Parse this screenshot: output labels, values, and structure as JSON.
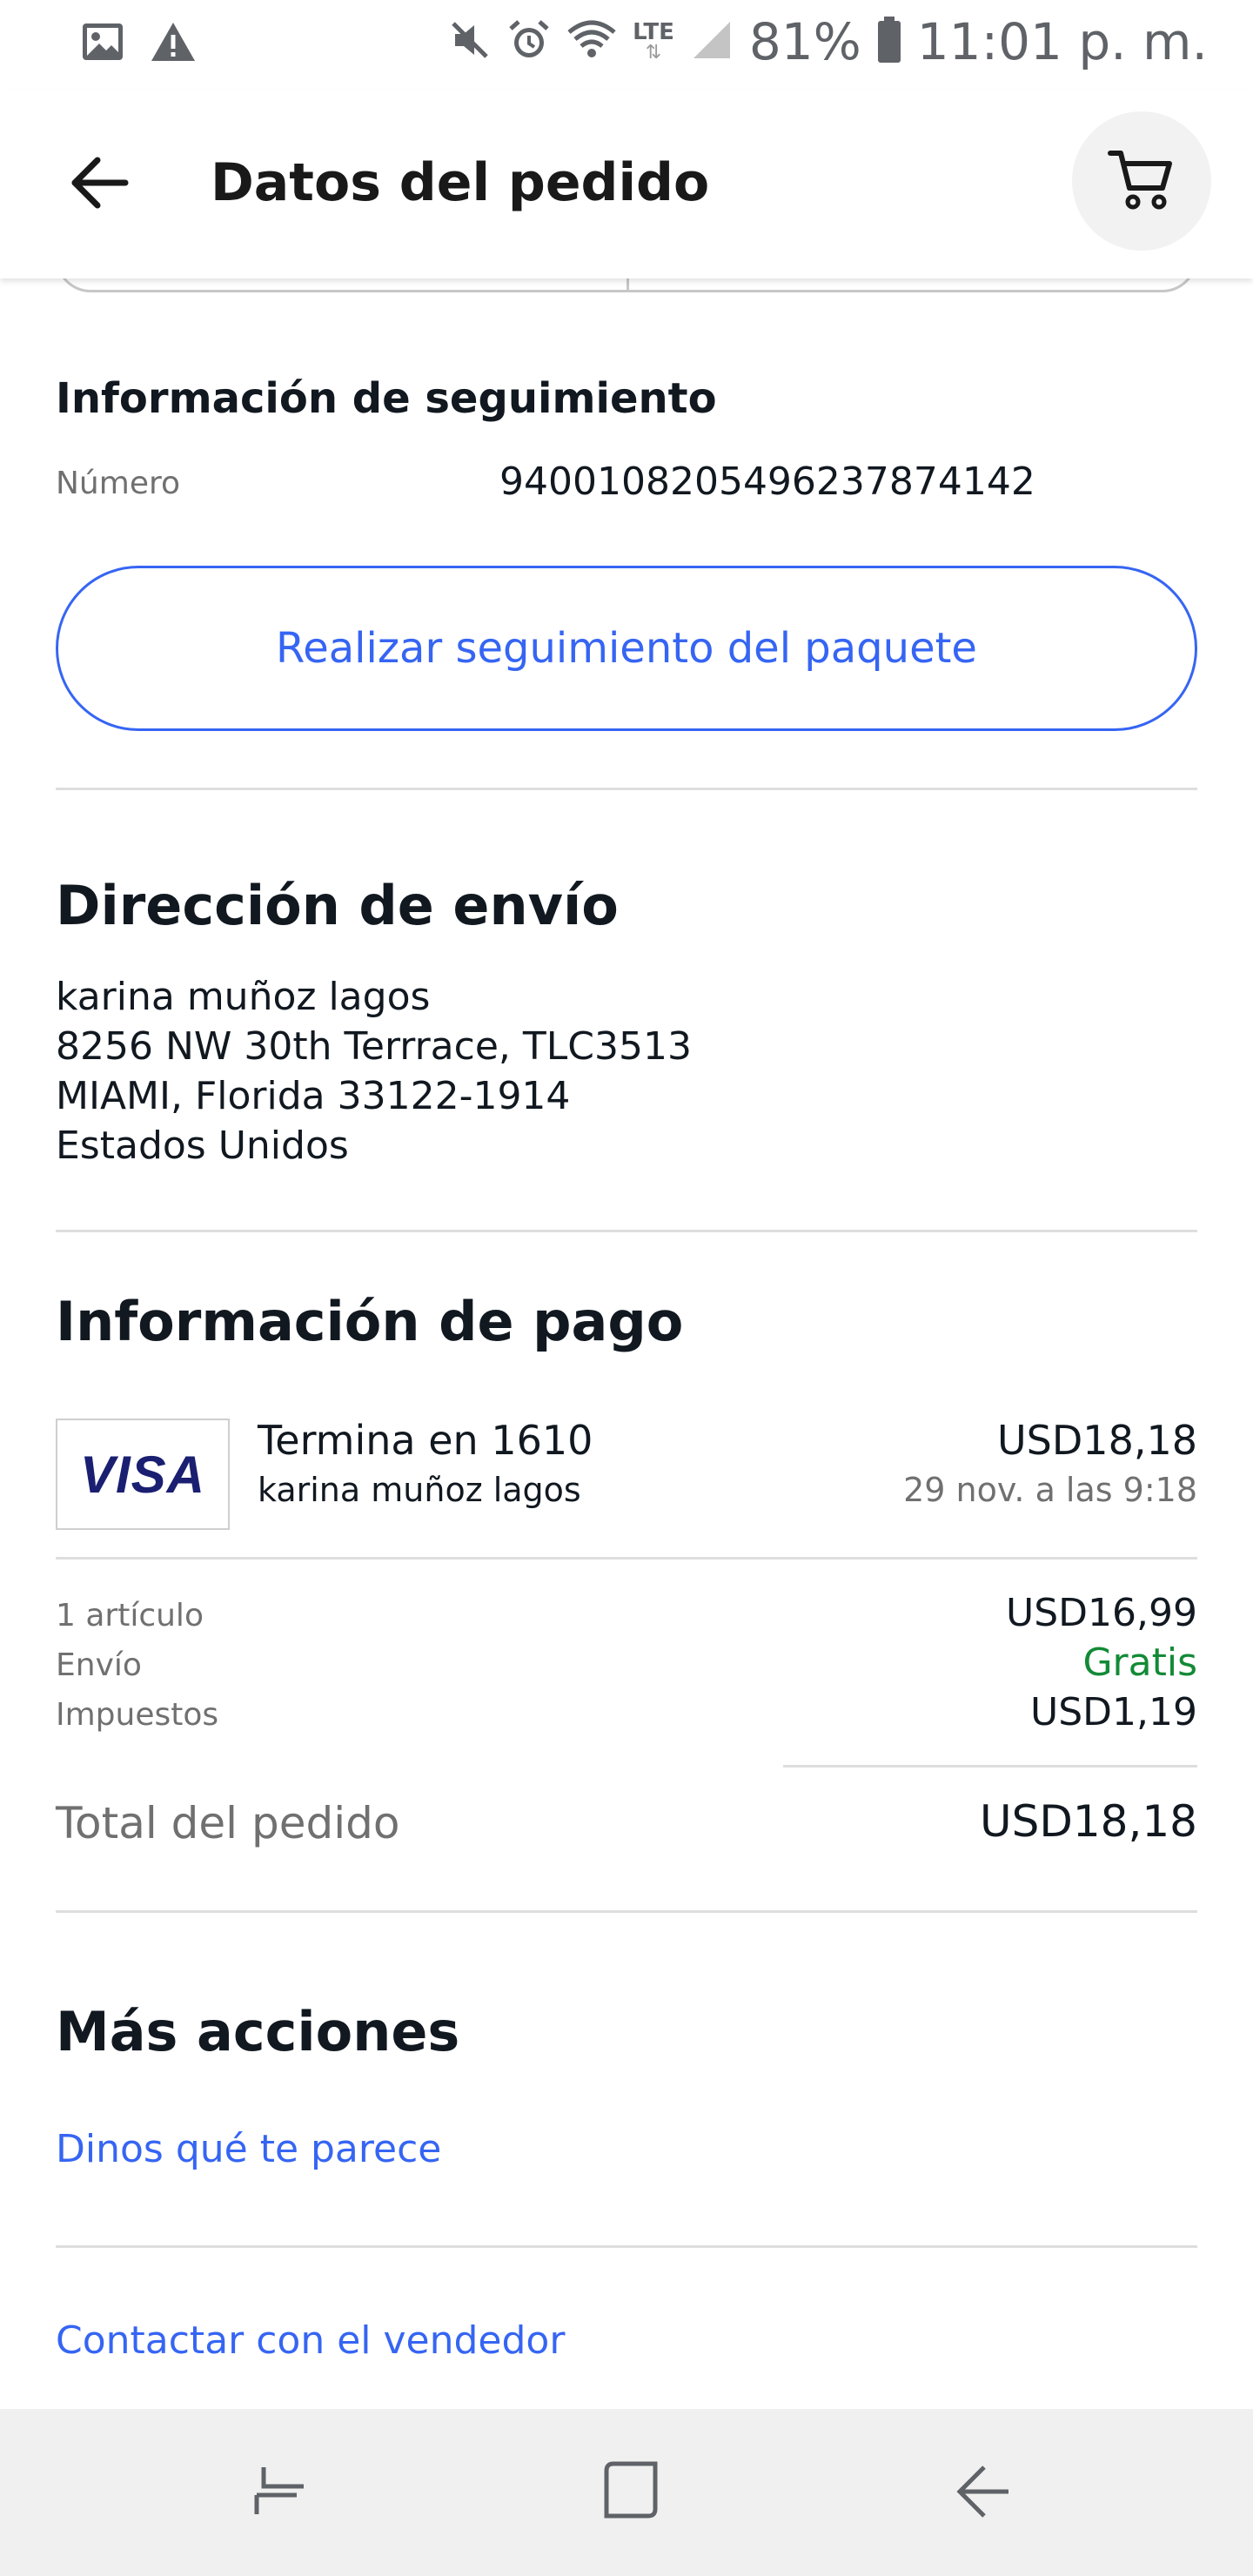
{
  "status_bar": {
    "icons_left": [
      "image-icon",
      "warning-icon"
    ],
    "icons_right": [
      "mute-icon",
      "alarm-icon",
      "wifi-icon",
      "lte-icon",
      "signal-icon",
      "battery-icon"
    ],
    "lte_label": "LTE",
    "battery": "81%",
    "time": "11:01 p. m."
  },
  "app_bar": {
    "title": "Datos del pedido",
    "back_icon": "arrow-back-icon",
    "cart_icon": "cart-icon"
  },
  "tracking": {
    "heading": "Información de seguimiento",
    "number_label": "Número",
    "number_value": "9400108205496237874142",
    "track_button": "Realizar seguimiento del paquete"
  },
  "shipping": {
    "heading": "Dirección de envío",
    "lines": [
      "karina muñoz lagos",
      "8256 NW 30th Terrrace, TLC3513",
      "MIAMI, Florida 33122-1914",
      "Estados Unidos"
    ]
  },
  "payment": {
    "heading": "Información de pago",
    "card_brand": "VISA",
    "card_title": "Termina en 1610",
    "card_holder": "karina muñoz lagos",
    "amount": "USD18,18",
    "date": "29 nov. a las 9:18",
    "summary": [
      {
        "label": "1 artículo",
        "value": "USD16,99"
      },
      {
        "label": "Envío",
        "value": "Gratis"
      },
      {
        "label": "Impuestos",
        "value": "USD1,19"
      }
    ],
    "total_label": "Total del pedido",
    "total_value": "USD18,18",
    "colors": {
      "link": "#3665f3",
      "free": "#138a36",
      "visa": "#1a1f71"
    }
  },
  "more_actions": {
    "heading": "Más acciones",
    "links": [
      "Dinos qué te parece",
      "Contactar con el vendedor"
    ]
  },
  "nav_bar": {
    "buttons": [
      "recent-apps-icon",
      "home-icon",
      "back-icon"
    ]
  }
}
